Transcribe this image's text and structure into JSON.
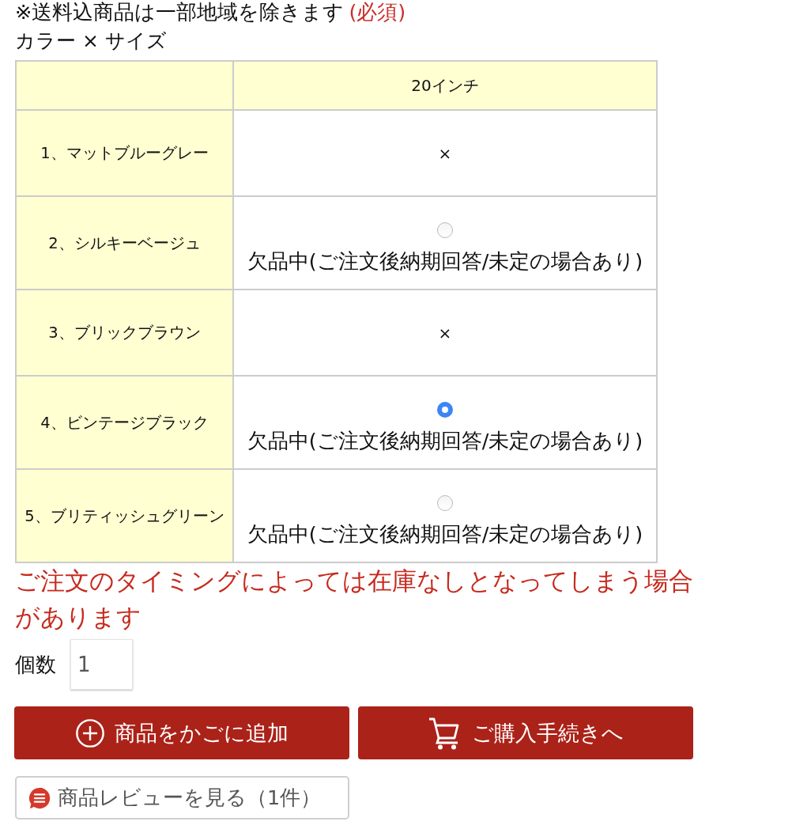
{
  "notice": {
    "text": "※送料込商品は一部地域を除きます",
    "required": "(必須)"
  },
  "option_label": "カラー × サイズ",
  "table": {
    "columns": [
      "20インチ"
    ],
    "rows": [
      {
        "label": "1、マットブルーグレー",
        "kind": "unavailable",
        "mark": "×"
      },
      {
        "label": "2、シルキーベージュ",
        "kind": "radio",
        "selected": false,
        "status": "欠品中(ご注文後納期回答/未定の場合あり)"
      },
      {
        "label": "3、ブリックブラウン",
        "kind": "unavailable",
        "mark": "×"
      },
      {
        "label": "4、ビンテージブラック",
        "kind": "radio",
        "selected": true,
        "status": "欠品中(ご注文後納期回答/未定の場合あり)"
      },
      {
        "label": "5、ブリティッシュグリーン",
        "kind": "radio",
        "selected": false,
        "status": "欠品中(ご注文後納期回答/未定の場合あり)"
      }
    ]
  },
  "stock_warning": "ご注文のタイミングによっては在庫なしとなってしまう場合があります",
  "quantity": {
    "label": "個数",
    "value": "1"
  },
  "buttons": [
    {
      "kind": "add",
      "label": "商品をかごに追加"
    },
    {
      "kind": "checkout",
      "label": "ご購入手続きへ"
    }
  ],
  "review_button": {
    "label": "商品レビューを見る（1件）"
  }
}
